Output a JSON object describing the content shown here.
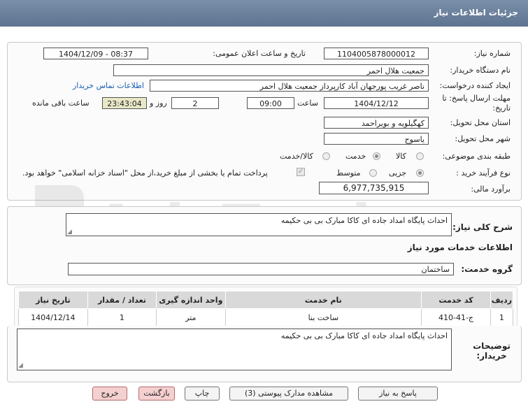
{
  "header": {
    "title": "جزئیات اطلاعات نیاز"
  },
  "form": {
    "need_number_label": "شماره نیاز:",
    "need_number": "1104005878000012",
    "announce_label": "تاریخ و ساعت اعلان عمومی:",
    "announce_value": "1404/12/09 - 08:37",
    "buyer_org_label": "نام دستگاه خریدار:",
    "buyer_org": "جمعیت هلال احمر",
    "creator_label": "ایجاد کننده درخواست:",
    "creator": "ناصر غریب پورجهان آباد کارپرداز جمعیت هلال احمر",
    "contact_link": "اطلاعات تماس خریدار",
    "deadline_label": "مهلت ارسال پاسخ: تا تاریخ:",
    "deadline_date": "1404/12/12",
    "time_label": "ساعت",
    "deadline_time": "09:00",
    "days_value": "2",
    "days_label": "روز و",
    "remaining_time": "23:43:04",
    "remaining_label": "ساعت باقی مانده",
    "province_label": "استان محل تحویل:",
    "province": "کهگیلویه و بویراحمد",
    "city_label": "شهر محل تحویل:",
    "city": "یاسوج",
    "category_label": "طبقه بندی موضوعی:",
    "category_options": [
      "کالا",
      "خدمت",
      "کالا/خدمت"
    ],
    "category_selected": "خدمت",
    "process_label": "نوع فرآیند خرید :",
    "process_options": [
      "جزیی",
      "متوسط"
    ],
    "process_selected": "جزیی",
    "payment_note": "پرداخت تمام یا بخشی از مبلغ خرید،از محل \"اسناد خزانه اسلامی\" خواهد بود.",
    "estimate_label": "برآورد مالی:",
    "estimate": "6,977,735,915"
  },
  "description": {
    "summary_label": "شرح کلی نیاز:",
    "summary": "احداث پایگاه امداد جاده ای کاکا مبارک بی بی حکیمه",
    "services_heading": "اطلاعات خدمات مورد نیاز",
    "service_group_label": "گروه خدمت:",
    "service_group": "ساختمان"
  },
  "table": {
    "headers": [
      "ردیف",
      "کد خدمت",
      "نام خدمت",
      "واحد اندازه گیری",
      "تعداد / مقدار",
      "تاریخ نیاز"
    ],
    "rows": [
      [
        "1",
        "ج-41-410",
        "ساخت بنا",
        "متر",
        "1",
        "1404/12/14"
      ]
    ]
  },
  "buyer_notes": {
    "label": "توضیحات خریدار:",
    "text": "احداث پایگاه امداد جاده ای کاکا مبارک بی بی حکیمه"
  },
  "buttons": {
    "reply": "پاسخ به نیاز",
    "attachments": "مشاهده مدارک پیوستی (3)",
    "print": "چاپ",
    "back": "بازگشت",
    "exit": "خروج"
  },
  "watermark": "AriaTender.neT"
}
